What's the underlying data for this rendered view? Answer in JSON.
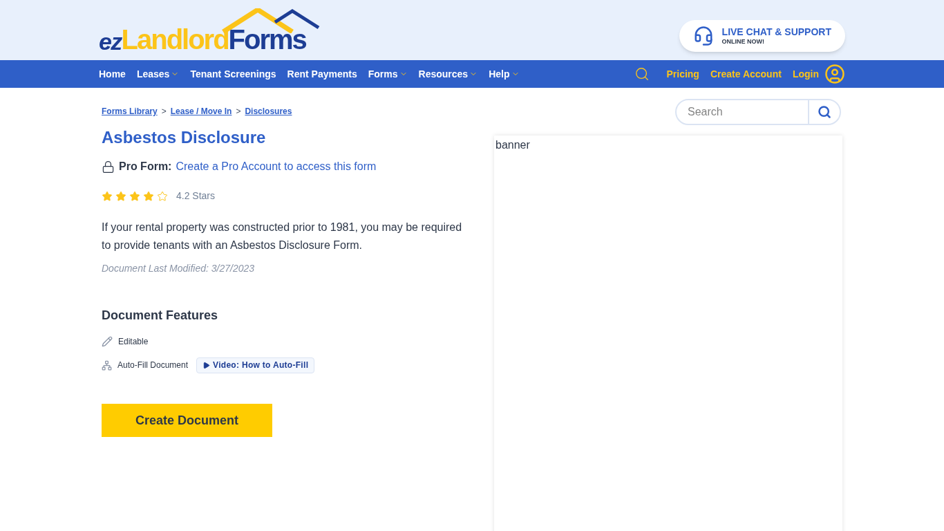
{
  "logo": {
    "prefix": "ez",
    "middle": "Landlord",
    "suffix": "Forms"
  },
  "support": {
    "title": "LIVE CHAT & SUPPORT",
    "subtitle": "ONLINE NOW!"
  },
  "nav": [
    {
      "label": "Home",
      "dropdown": false
    },
    {
      "label": "Leases",
      "dropdown": true
    },
    {
      "label": "Tenant Screenings",
      "dropdown": false
    },
    {
      "label": "Rent Payments",
      "dropdown": false
    },
    {
      "label": "Forms",
      "dropdown": true
    },
    {
      "label": "Resources",
      "dropdown": true
    },
    {
      "label": "Help",
      "dropdown": true
    }
  ],
  "nav_right": [
    "Pricing",
    "Create Account",
    "Login"
  ],
  "breadcrumbs": [
    "Forms Library",
    "Lease / Move In",
    "Disclosures"
  ],
  "breadcrumb_separator": ">",
  "search": {
    "placeholder": "Search"
  },
  "title": "Asbestos Disclosure",
  "pro": {
    "label": "Pro Form:",
    "link": "Create a Pro Account to access this form"
  },
  "rating": {
    "stars": 4,
    "text": "4.2 Stars"
  },
  "description": "If your rental property was constructed prior to 1981, you may be required to provide tenants with an Asbestos Disclosure Form.",
  "modified": "Document Last Modified: 3/27/2023",
  "features_heading": "Document Features",
  "features": [
    {
      "kind": "edit",
      "label": "Editable"
    },
    {
      "kind": "autofill",
      "label": "Auto-Fill Document",
      "video": "Video: How to Auto-Fill"
    }
  ],
  "cta": "Create Document",
  "banner_alt": "banner"
}
